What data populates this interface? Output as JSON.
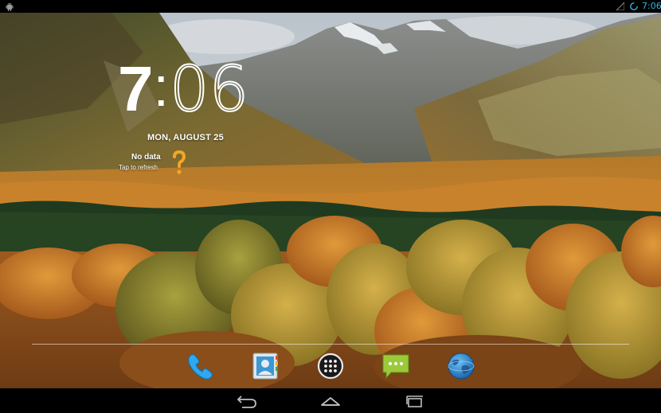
{
  "status_bar": {
    "time": "7:06",
    "icons": [
      "android-debug-icon",
      "signal-icon",
      "sync-icon"
    ],
    "time_color": "#33b5e5"
  },
  "clock_widget": {
    "hour": "7",
    "separator": ":",
    "minutes": "06",
    "date": "MON, AUGUST 25"
  },
  "weather_widget": {
    "title": "No data",
    "subtitle": "Tap to refresh",
    "icon": "question-mark-icon",
    "icon_color": "#f5a623"
  },
  "dock": {
    "items": [
      {
        "name": "phone",
        "icon": "phone-icon"
      },
      {
        "name": "contacts",
        "icon": "contacts-icon"
      },
      {
        "name": "all-apps",
        "icon": "app-drawer-icon"
      },
      {
        "name": "messaging",
        "icon": "messaging-icon"
      },
      {
        "name": "browser",
        "icon": "globe-icon"
      }
    ]
  },
  "nav_bar": {
    "buttons": [
      "back-icon",
      "home-icon",
      "recents-icon"
    ]
  }
}
